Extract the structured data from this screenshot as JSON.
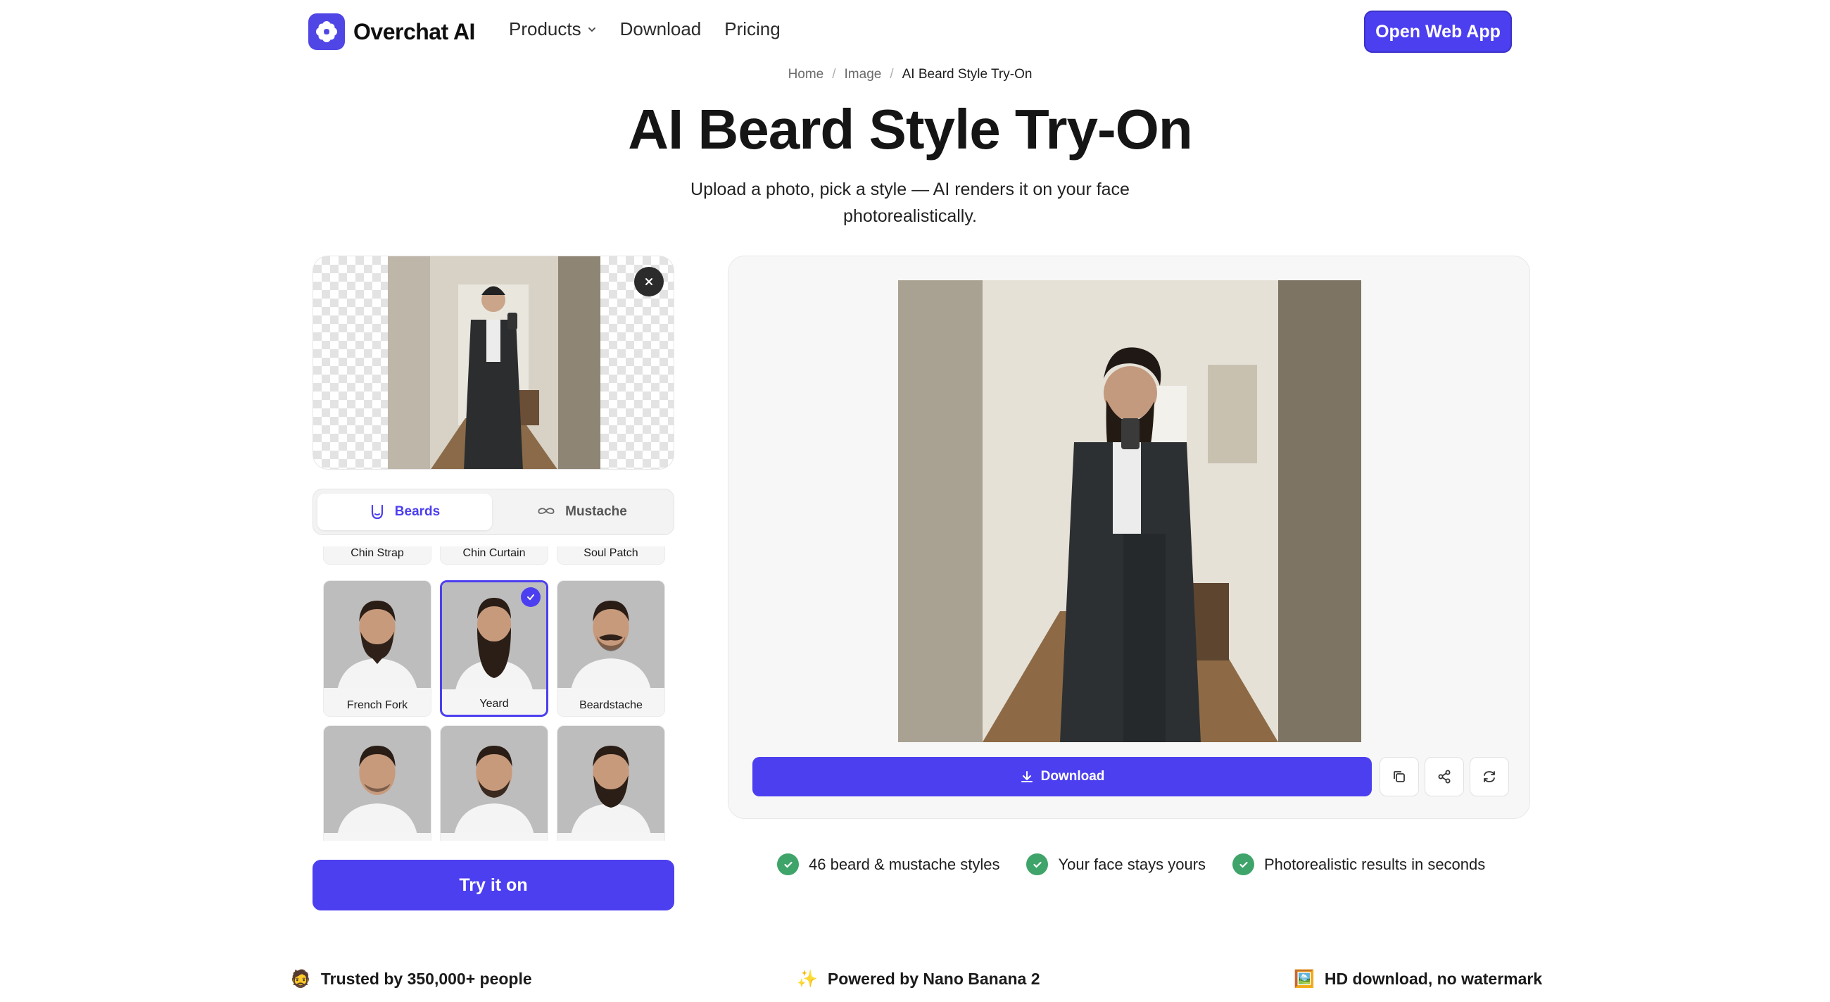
{
  "nav": {
    "brand": "Overchat AI",
    "links": [
      "Products",
      "Download",
      "Pricing"
    ],
    "cta": "Open Web App"
  },
  "breadcrumb": [
    "Home",
    "Image",
    "AI Beard Style Try-On"
  ],
  "hero": {
    "title": "AI Beard Style Try-On",
    "subtitle": "Upload a photo, pick a style — AI renders it on your face photorealistically."
  },
  "tabs": [
    "Beards",
    "Mustache"
  ],
  "styles": {
    "top_row_partial": [
      "Chin Strap",
      "Chin Curtain",
      "Soul Patch"
    ],
    "row": [
      "French Fork",
      "Yeard",
      "Beardstache"
    ],
    "selected": "Yeard"
  },
  "try_button": "Try it on",
  "result": {
    "download": "Download"
  },
  "features": [
    "46 beard & mustache styles",
    "Your face stays yours",
    "Photorealistic results in seconds"
  ],
  "trust": [
    {
      "icon": "🧔",
      "text": "Trusted by 350,000+ people"
    },
    {
      "icon": "✨",
      "text": "Powered by Nano Banana 2"
    },
    {
      "icon": "🖼️",
      "text": "HD download, no watermark"
    }
  ],
  "colors": {
    "accent": "#4c3ff0",
    "success": "#3fa46a"
  }
}
